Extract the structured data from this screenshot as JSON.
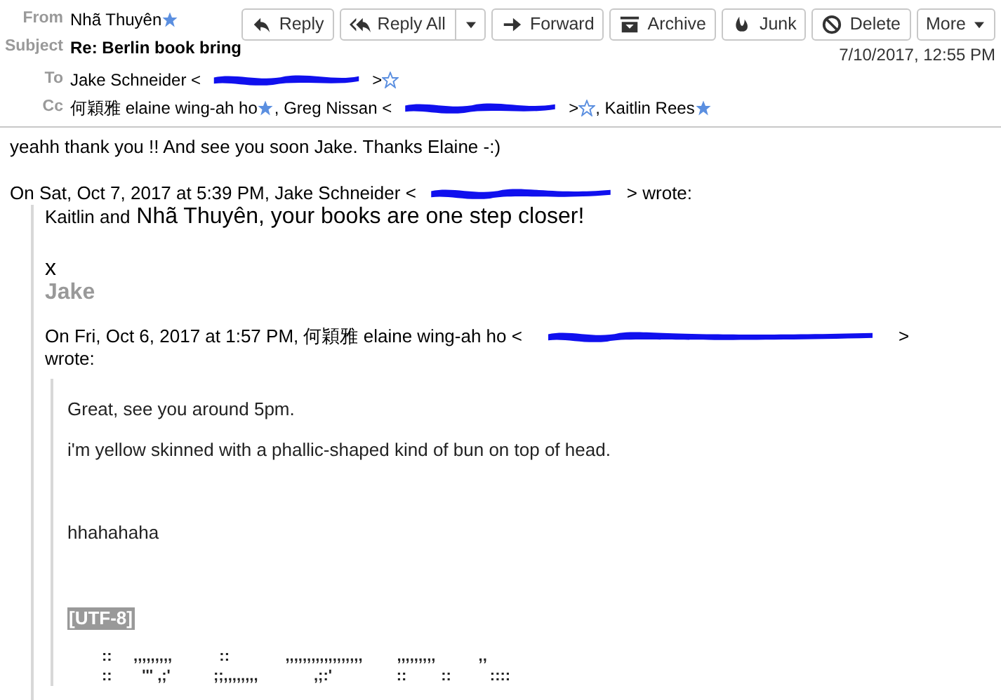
{
  "toolbar": {
    "buttons": [
      {
        "kind": "reply",
        "label": "Reply",
        "dropdown": false
      },
      {
        "kind": "reply_all",
        "label": "Reply All",
        "dropdown": true
      },
      {
        "kind": "forward",
        "label": "Forward",
        "dropdown": false
      },
      {
        "kind": "archive",
        "label": "Archive",
        "dropdown": false
      },
      {
        "kind": "junk",
        "label": "Junk",
        "dropdown": false
      },
      {
        "kind": "delete",
        "label": "Delete",
        "dropdown": false
      },
      {
        "kind": "more",
        "label": "More",
        "dropdown": true
      }
    ]
  },
  "header": {
    "from": {
      "label": "From",
      "name": "Nhã Thuyên",
      "starred": true
    },
    "subject": {
      "label": "Subject",
      "text": "Re: Berlin book bring"
    },
    "date": "7/10/2017, 12:55 PM",
    "to": {
      "label": "To",
      "recipients": [
        {
          "before": "Jake Schneider <",
          "redacted": true,
          "after": ">",
          "starred": false
        }
      ]
    },
    "cc": {
      "label": "Cc",
      "recipients": [
        {
          "before": "何穎雅 elaine wing-ah ho",
          "redacted": false,
          "starred": true
        },
        {
          "before": ", Greg Nissan <",
          "redacted": true,
          "after": ">",
          "starred": false
        },
        {
          "before": ", Kaitlin Rees",
          "redacted": false,
          "starred": true
        }
      ]
    }
  },
  "body": {
    "reply": "yeahh thank you !! And see you soon Jake. Thanks Elaine -:)",
    "quote_intro": {
      "before": "On Sat, Oct 7, 2017 at 5:39 PM, Jake Schneider <",
      "after": "> wrote:"
    },
    "quote": {
      "line_small": "Kaitlin and",
      "line_large": "Nhã Thuyên, your books are one step closer!",
      "sign": "x",
      "signature": "Jake",
      "nested_intro": {
        "before": "On Fri, Oct 6, 2017 at 1:57 PM, 何穎雅 elaine wing-ah ho <",
        "after": ">",
        "wrote": "wrote:"
      },
      "nested": {
        "paragraphs": [
          "Great, see you around 5pm.",
          "i'm yellow skinned with a phallic-shaped kind of bun on top of head.",
          "hhahahaha"
        ],
        "charset": "[UTF-8]",
        "art": [
          "        ::     ,,,,,,,,,           ::             ,,,,,,,,,,,,,,,,,,        ,,,,,,,,,          ,,",
          "        ::       ''' ,;'          ;;,,,,,,,,             ,;:'               ::        ::         ::::"
        ]
      }
    }
  }
}
